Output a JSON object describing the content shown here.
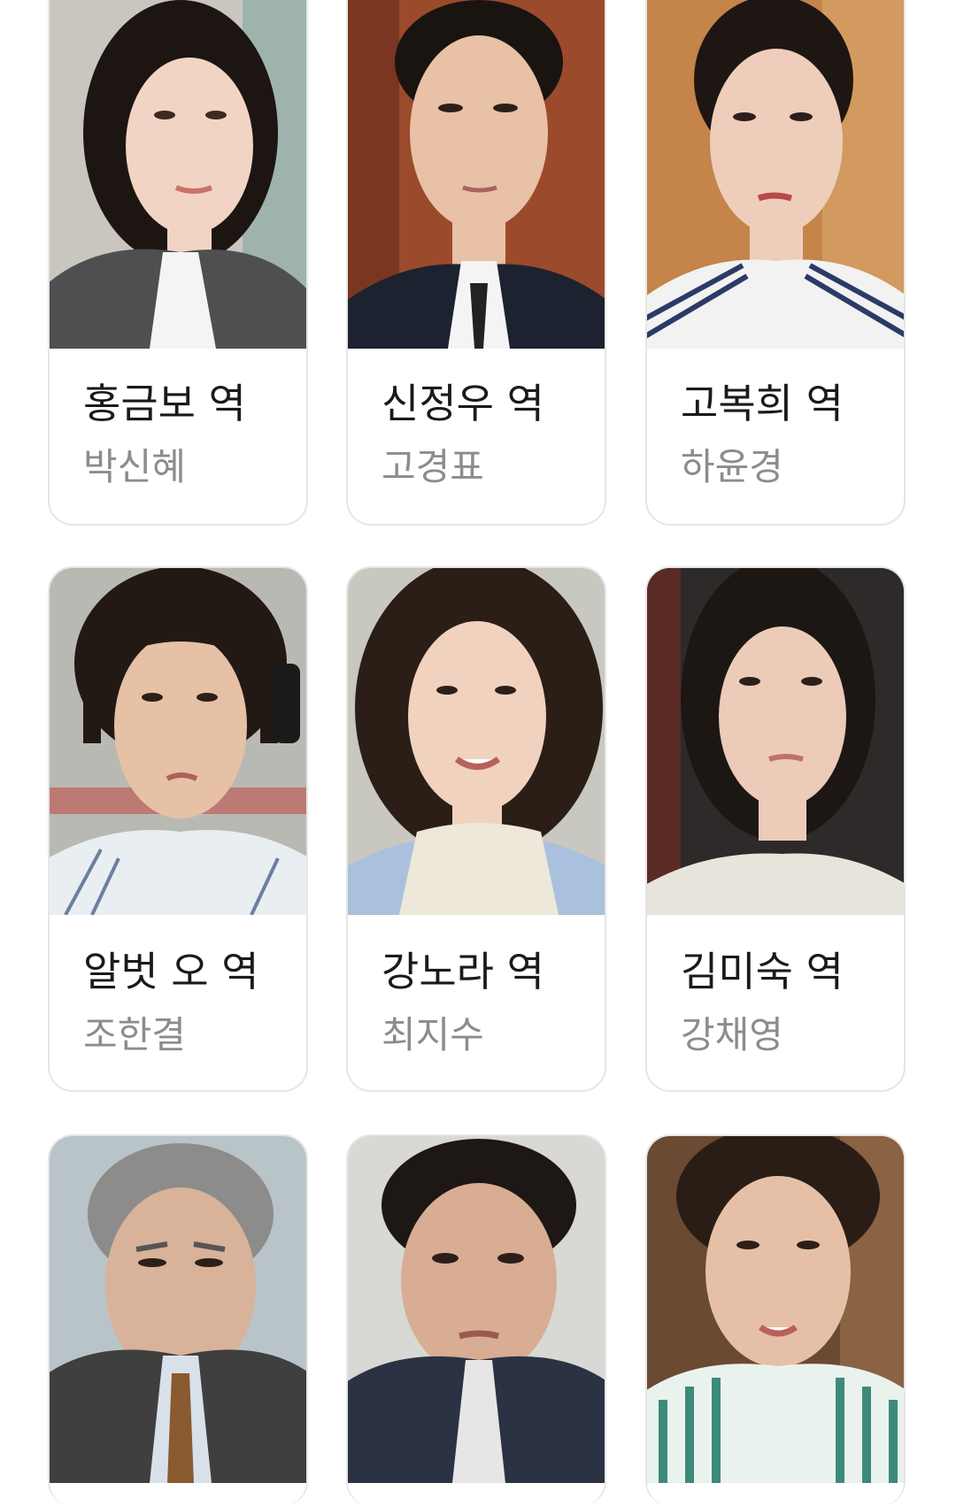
{
  "cast": [
    {
      "role": "홍금보 역",
      "actor": "박신혜",
      "bg": "#c9c6c0",
      "hair": "#1c1512",
      "skin": "#f1d4c4",
      "cloth": "#4e4f50"
    },
    {
      "role": "신정우 역",
      "actor": "고경표",
      "bg": "#9c4a2c",
      "hair": "#1a1411",
      "skin": "#e8c1a6",
      "cloth": "#1d2230"
    },
    {
      "role": "고복희 역",
      "actor": "하윤경",
      "bg": "#c4844a",
      "hair": "#1d1613",
      "skin": "#efcdbb",
      "cloth": "#f2f2f2"
    },
    {
      "role": "알벗 오 역",
      "actor": "조한결",
      "bg": "#b9b9b3",
      "hair": "#231914",
      "skin": "#e6c1a7",
      "cloth": "#e9eef2"
    },
    {
      "role": "강노라 역",
      "actor": "최지수",
      "bg": "#c8c8c0",
      "hair": "#2a1e17",
      "skin": "#f0d2bf",
      "cloth": "#eee8da"
    },
    {
      "role": "김미숙 역",
      "actor": "강채영",
      "bg": "#2d2a29",
      "hair": "#1d1714",
      "skin": "#eccbb9",
      "cloth": "#e7e4dc"
    },
    {
      "role": "",
      "actor": "",
      "bg": "#b8c4c8",
      "hair": "#8d8c8a",
      "skin": "#d9b29a",
      "cloth": "#3f3f3f"
    },
    {
      "role": "",
      "actor": "",
      "bg": "#d8d8d4",
      "hair": "#1d1815",
      "skin": "#d9ad93",
      "cloth": "#2a3244"
    },
    {
      "role": "",
      "actor": "",
      "bg": "#6a4a32",
      "hair": "#2a1d16",
      "skin": "#e6c0a6",
      "cloth": "#3c8a7a"
    }
  ]
}
